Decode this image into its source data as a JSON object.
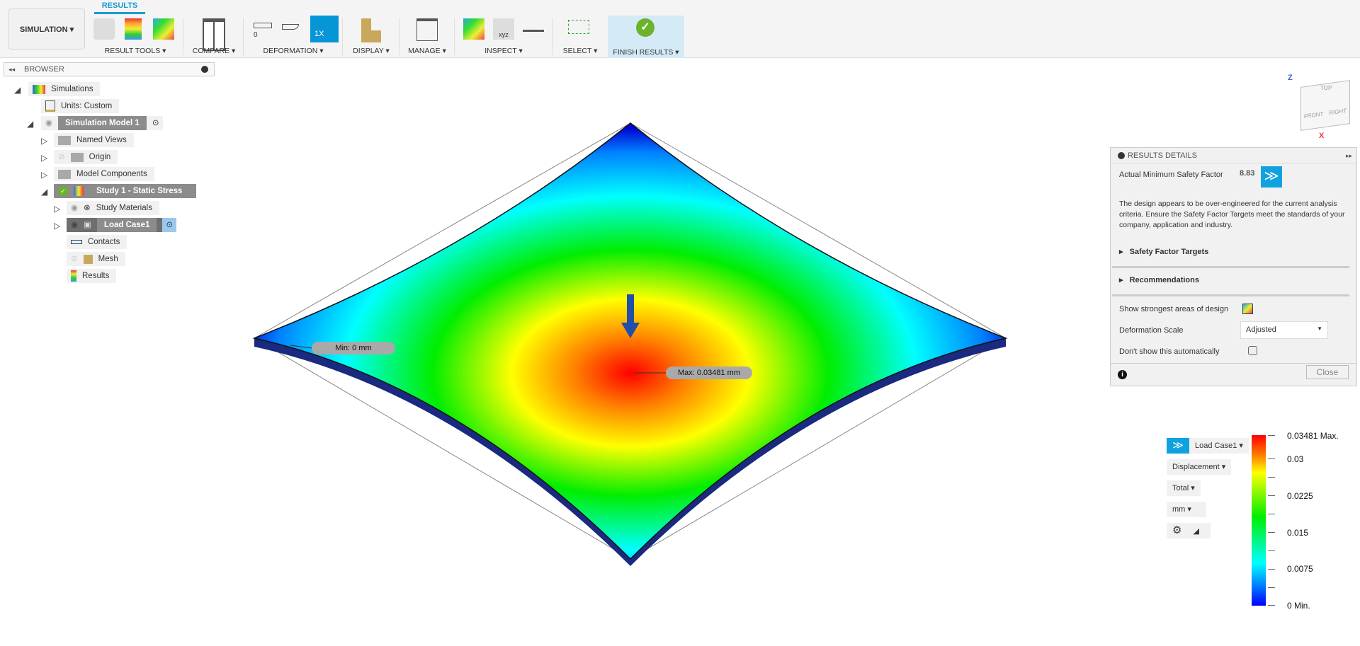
{
  "toolbar": {
    "workspace": "SIMULATION ▾",
    "active_tab": "RESULTS",
    "groups": [
      "RESULT TOOLS ▾",
      "COMPARE ▾",
      "DEFORMATION ▾",
      "DISPLAY ▾",
      "MANAGE ▾",
      "INSPECT ▾",
      "SELECT ▾",
      "FINISH RESULTS ▾"
    ],
    "deformation_zero": "0",
    "deformation_1x": "1X",
    "accent": "#0696d7"
  },
  "browser": {
    "title": "BROWSER",
    "items": [
      {
        "label": "Simulations"
      },
      {
        "label": "Units: Custom"
      },
      {
        "label": "Simulation Model 1"
      },
      {
        "label": "Named Views"
      },
      {
        "label": "Origin"
      },
      {
        "label": "Model Components"
      },
      {
        "label": "Study 1 - Static Stress"
      },
      {
        "label": "Study Materials"
      },
      {
        "label": "Load Case1"
      },
      {
        "label": "Contacts"
      },
      {
        "label": "Mesh"
      },
      {
        "label": "Results"
      }
    ]
  },
  "viewport": {
    "min_label": "Min: 0 mm",
    "max_label": "Max: 0.03481 mm"
  },
  "viewcube": {
    "top": "TOP",
    "front": "FRONT",
    "right": "RIGHT",
    "z": "Z",
    "x": "X"
  },
  "results_details": {
    "title": "RESULTS DETAILS",
    "safety_label": "Actual Minimum Safety Factor",
    "safety_value": "8.83",
    "message": "The design appears to be over-engineered for the current analysis criteria. Ensure the Safety Factor Targets meet the standards of your company, application and industry.",
    "section1": "Safety Factor Targets",
    "section2": "Recommendations",
    "strongest": "Show strongest areas of design",
    "deform_label": "Deformation Scale",
    "deform_value": "Adjusted",
    "dont_show": "Don't show this automatically",
    "dont_show_checked": false,
    "close": "Close"
  },
  "legend": {
    "load_case": "Load Case1 ▾",
    "result_type": "Displacement  ▾",
    "component": "Total ▾",
    "unit": "mm  ▾",
    "ticks": [
      "0.03481 Max.",
      "0.03",
      "0.0225",
      "0.015",
      "0.0075",
      "0 Min."
    ]
  }
}
